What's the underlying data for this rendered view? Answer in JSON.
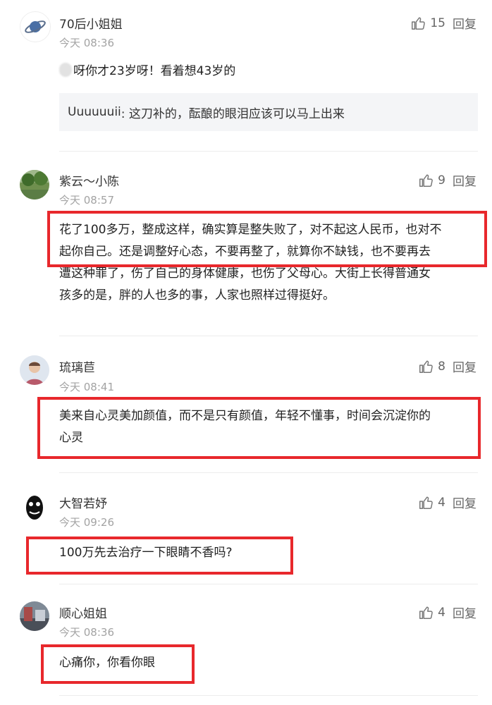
{
  "comments": [
    {
      "username": "70后小姐姐",
      "time": "今天 08:36",
      "likes": "15",
      "reply": "回复",
      "text": "呀你才23岁呀！看着想43岁的",
      "quote_user": "Uuuuuuii",
      "quote_text": " : 这刀补的，酝酿的眼泪应该可以马上出来",
      "avatar_icon": "planet-icon"
    },
    {
      "username": "紫云～小陈",
      "time": "今天 08:57",
      "likes": "9",
      "reply": "回复",
      "lines": [
        "花了100多万，整成这样，确实算是整失败了，对不起这人民币，也对不",
        "起你自己。还是调整好心态，不要再整了，就算你不缺钱，也不要再去",
        "遭这种罪了，伤了自己的身体健康，也伤了父母心。大街上长得普通女",
        "孩多的是，胖的人也多的事，人家也照样过得挺好。"
      ]
    },
    {
      "username": "琉璃苣",
      "time": "今天 08:41",
      "likes": "8",
      "reply": "回复",
      "lines": [
        "美来自心灵美加颜值，而不是只有颜值，年轻不懂事，时间会沉淀你的",
        "心灵"
      ]
    },
    {
      "username": "大智若妤",
      "time": "今天 09:26",
      "likes": "4",
      "reply": "回复",
      "text": "100万先去治疗一下眼睛不香吗?"
    },
    {
      "username": "顺心姐姐",
      "time": "今天 08:36",
      "likes": "4",
      "reply": "回复",
      "text": "心痛你，你看你眼"
    }
  ],
  "colors": {
    "highlight": "#e8282c",
    "quote_bg": "#f4f5f7",
    "time": "#a3a3a3"
  }
}
